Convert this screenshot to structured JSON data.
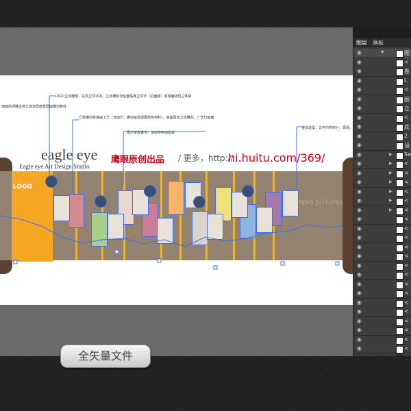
{
  "artboard": {
    "watermark": {
      "brand": "eagle eye",
      "studio": "Eagle eye Art Design Studio",
      "cn_label": "鹰眼原创出品",
      "separator": "/ 更多，http://",
      "url": "hi.huitu.com/369/"
    },
    "logo_text": "LOGO",
    "sample_text": "Sample pictures",
    "callouts": [
      "LOGO立体雕刻，在刻立体字的，立体雕刻背后面贴做立体字（前面钢）或墙面结构立体架",
      "墙面前浮雕主体立体造型面宽原面雕刻物体",
      "立体雕刻挂墙画工艺（背面光，雕刻画需组框结构材料）。墙面固定立体雕刻。广告灯画面",
      "展示架板装饰，墙面使用墙面板",
      "整体造型，文字内容积分，现场，采取打文字"
    ]
  },
  "layers_panel": {
    "tabs": [
      "图层",
      "画板"
    ],
    "rows": [
      {
        "label": "图层",
        "expanded": true
      },
      {
        "label": "<"
      },
      {
        "label": "卷"
      },
      {
        "label": "L"
      },
      {
        "label": "<"
      },
      {
        "label": "图"
      },
      {
        "label": "立"
      },
      {
        "label": "<"
      },
      {
        "label": "底"
      },
      {
        "label": "2"
      },
      {
        "label": "设"
      },
      {
        "label": "Se"
      },
      {
        "label": "<"
      },
      {
        "label": "<"
      },
      {
        "label": "<"
      },
      {
        "label": "<"
      },
      {
        "label": "<"
      },
      {
        "label": "<"
      },
      {
        "label": "<"
      },
      {
        "label": "<"
      },
      {
        "label": "<"
      },
      {
        "label": "<"
      },
      {
        "label": "<"
      },
      {
        "label": "<"
      },
      {
        "label": "<"
      },
      {
        "label": "<"
      },
      {
        "label": "<"
      },
      {
        "label": "<"
      },
      {
        "label": "<"
      },
      {
        "label": "<"
      },
      {
        "label": "<"
      },
      {
        "label": "<"
      },
      {
        "label": "<"
      },
      {
        "label": "<"
      }
    ]
  },
  "badge": {
    "label": "全矢量文件"
  },
  "colors": {
    "board": "#93826f",
    "accent": "#f5a623",
    "selection": "#3d6cf0",
    "watermark_red": "#d0021b"
  }
}
